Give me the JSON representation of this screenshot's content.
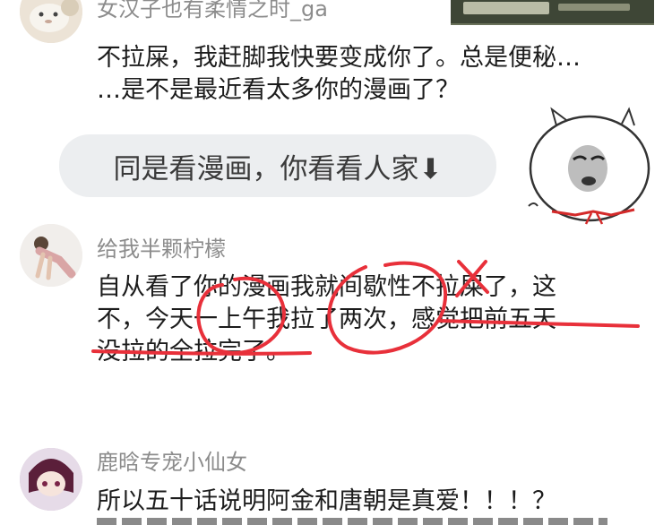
{
  "comments": [
    {
      "username": "女汉子也有柔情之时_ga",
      "lines": [
        "不拉屎，我赶脚我快要变成你了。总是便秘…",
        "…是不是最近看太多你的漫画了？"
      ]
    },
    {
      "username": "给我半颗柠檬",
      "lines": [
        "自从看了你的漫画我就间歇性不拉屎了，这",
        "不，今天一上午我拉了两次，感觉把前五天",
        "没拉的全拉完了。"
      ]
    },
    {
      "username": "鹿晗专宠小仙女",
      "lines": [
        "所以五十话说明阿金和唐朝是真爱！！！？"
      ]
    }
  ],
  "bubble_text": "同是看漫画，你看看人家⬇",
  "annotation_color": "#e8303a",
  "icons": [
    "meme-face-sticker",
    "avatar-plush-toy",
    "avatar-yoga-girl",
    "avatar-anime-girl",
    "top-thumbnail"
  ]
}
